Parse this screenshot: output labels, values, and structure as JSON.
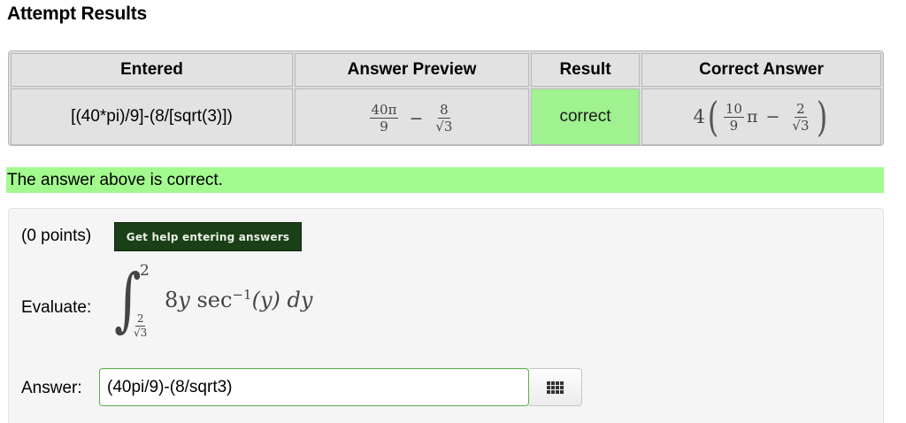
{
  "header": {
    "title": "Attempt Results"
  },
  "results_table": {
    "columns": [
      "Entered",
      "Answer Preview",
      "Result",
      "Correct Answer"
    ],
    "row": {
      "entered": "[(40*pi)/9]-(8/[sqrt(3)])",
      "preview": {
        "term1_num": "40π",
        "term1_den": "9",
        "operator": "−",
        "term2_num": "8",
        "term2_den": "√3"
      },
      "result": "correct",
      "correct_answer": {
        "coefficient": "4",
        "open_paren": "(",
        "frac1_num": "10",
        "frac1_den": "9",
        "pi": "π",
        "operator": "−",
        "frac2_num": "2",
        "frac2_den": "√3",
        "close_paren": ")"
      }
    }
  },
  "status": {
    "message": "The answer above is correct."
  },
  "problem": {
    "points": "(0 points)",
    "help_button_label": "Get help entering answers",
    "evaluate_label": "Evaluate:",
    "integral": {
      "sign": "∫",
      "upper_limit": "2",
      "lower_limit_num": "2",
      "lower_limit_den": "√3",
      "integrand_coef": "8",
      "integrand_var": "y",
      "function": "sec",
      "exponent": "−1",
      "argument": "(y)",
      "differential": "dy"
    },
    "answer_label": "Answer:",
    "answer_value": "(40pi/9)-(8/sqrt3)"
  },
  "colors": {
    "correct_green": "#9ff28f",
    "banner_green": "#a3fa8f",
    "help_button_bg": "#1b3f17"
  },
  "icons": {
    "equation_editor": "grid-icon"
  }
}
